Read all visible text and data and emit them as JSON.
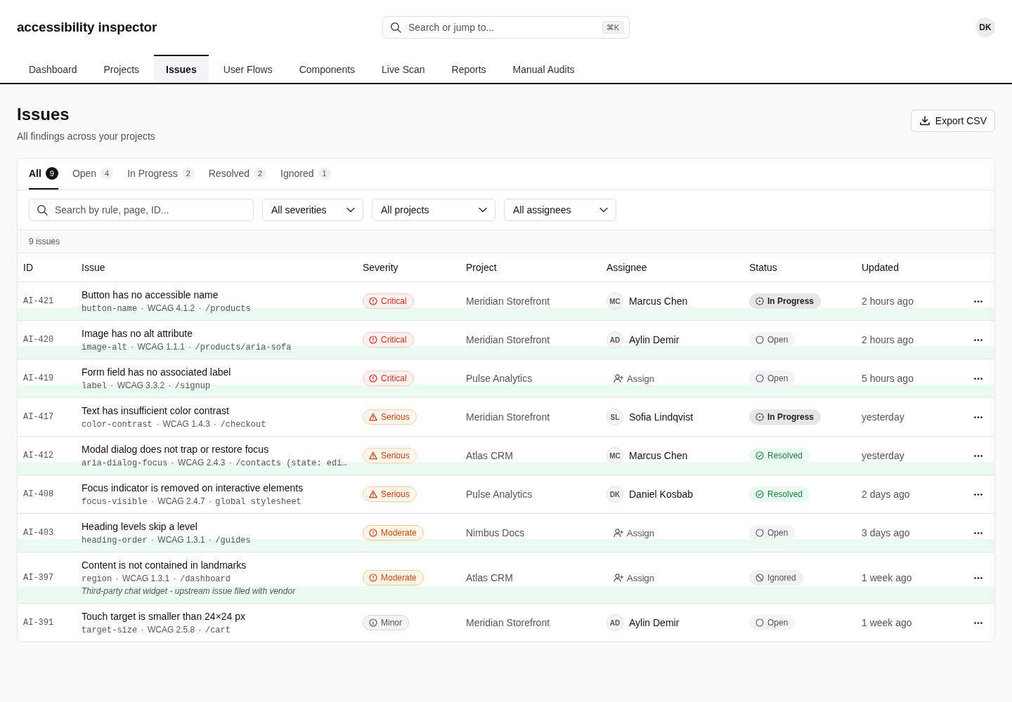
{
  "app": {
    "title": "accessibility inspector",
    "search": {
      "placeholder": "Search or jump to...",
      "shortcut": "⌘K"
    },
    "user_initials": "DK"
  },
  "nav_tabs": [
    {
      "label": "Dashboard",
      "selected": false
    },
    {
      "label": "Projects",
      "selected": false
    },
    {
      "label": "Issues",
      "selected": true
    },
    {
      "label": "User Flows",
      "selected": false
    },
    {
      "label": "Components",
      "selected": false
    },
    {
      "label": "Live Scan",
      "selected": false
    },
    {
      "label": "Reports",
      "selected": false
    },
    {
      "label": "Manual Audits",
      "selected": false
    }
  ],
  "page": {
    "title": "Issues",
    "subtitle": "All findings across your projects",
    "export_button": "Export CSV"
  },
  "status_tabs": [
    {
      "label": "All",
      "count": "9",
      "selected": true
    },
    {
      "label": "Open",
      "count": "4",
      "selected": false
    },
    {
      "label": "In Progress",
      "count": "2",
      "selected": false
    },
    {
      "label": "Resolved",
      "count": "2",
      "selected": false
    },
    {
      "label": "Ignored",
      "count": "1",
      "selected": false
    }
  ],
  "filters": {
    "search_placeholder": "Search by rule, page, ID...",
    "selects": [
      "All severities",
      "All projects",
      "All assignees"
    ]
  },
  "result_count": "9 issues",
  "table": {
    "columns": [
      "ID",
      "Issue",
      "Severity",
      "Project",
      "Assignee",
      "Status",
      "Updated"
    ],
    "rows": [
      {
        "id": "AI-421",
        "title": "Button has no accessible name",
        "meta": [
          {
            "kind": "code",
            "text": "button-name"
          },
          {
            "kind": "sep",
            "text": "·"
          },
          {
            "kind": "plain",
            "text": "WCAG 4.1.2"
          },
          {
            "kind": "sep",
            "text": "·"
          },
          {
            "kind": "code",
            "text": "/products"
          }
        ],
        "severity": {
          "kind": "critical",
          "label": "Critical"
        },
        "project": "Meridian Storefront",
        "assignee": {
          "kind": "person",
          "initials": "MC",
          "name": "Marcus Chen"
        },
        "status": {
          "kind": "in_progress",
          "label": "In Progress"
        },
        "updated": "2 hours ago",
        "highlighted": true
      },
      {
        "id": "AI-420",
        "title": "Image has no alt attribute",
        "meta": [
          {
            "kind": "code",
            "text": "image-alt"
          },
          {
            "kind": "sep",
            "text": "·"
          },
          {
            "kind": "plain",
            "text": "WCAG 1.1.1"
          },
          {
            "kind": "sep",
            "text": "·"
          },
          {
            "kind": "code",
            "text": "/products/aria-sofa"
          }
        ],
        "severity": {
          "kind": "critical",
          "label": "Critical"
        },
        "project": "Meridian Storefront",
        "assignee": {
          "kind": "person",
          "initials": "AD",
          "name": "Aylin Demir"
        },
        "status": {
          "kind": "open",
          "label": "Open"
        },
        "updated": "2 hours ago",
        "highlighted": true
      },
      {
        "id": "AI-419",
        "title": "Form field has no associated label",
        "meta": [
          {
            "kind": "code",
            "text": "label"
          },
          {
            "kind": "sep",
            "text": "·"
          },
          {
            "kind": "plain",
            "text": "WCAG 3.3.2"
          },
          {
            "kind": "sep",
            "text": "·"
          },
          {
            "kind": "code",
            "text": "/signup"
          }
        ],
        "severity": {
          "kind": "critical",
          "label": "Critical"
        },
        "project": "Pulse Analytics",
        "assignee": {
          "kind": "unassigned",
          "label": "Assign"
        },
        "status": {
          "kind": "open",
          "label": "Open"
        },
        "updated": "5 hours ago",
        "highlighted": true
      },
      {
        "id": "AI-417",
        "title": "Text has insufficient color contrast",
        "meta": [
          {
            "kind": "code",
            "text": "color-contrast"
          },
          {
            "kind": "sep",
            "text": "·"
          },
          {
            "kind": "plain",
            "text": "WCAG 1.4.3"
          },
          {
            "kind": "sep",
            "text": "·"
          },
          {
            "kind": "code",
            "text": "/checkout"
          }
        ],
        "severity": {
          "kind": "serious",
          "label": "Serious"
        },
        "project": "Meridian Storefront",
        "assignee": {
          "kind": "person",
          "initials": "SL",
          "name": "Sofia Lindqvist"
        },
        "status": {
          "kind": "in_progress",
          "label": "In Progress"
        },
        "updated": "yesterday",
        "highlighted": false
      },
      {
        "id": "AI-412",
        "title": "Modal dialog does not trap or restore focus",
        "meta": [
          {
            "kind": "code",
            "text": "aria-dialog-focus"
          },
          {
            "kind": "sep",
            "text": "·"
          },
          {
            "kind": "plain",
            "text": "WCAG 2.4.3"
          },
          {
            "kind": "sep",
            "text": "·"
          },
          {
            "kind": "code",
            "text": "/contacts (state: edi…"
          }
        ],
        "severity": {
          "kind": "serious",
          "label": "Serious"
        },
        "project": "Atlas CRM",
        "assignee": {
          "kind": "person",
          "initials": "MC",
          "name": "Marcus Chen"
        },
        "status": {
          "kind": "resolved",
          "label": "Resolved"
        },
        "updated": "yesterday",
        "highlighted": true
      },
      {
        "id": "AI-408",
        "title": "Focus indicator is removed on interactive elements",
        "meta": [
          {
            "kind": "code",
            "text": "focus-visible"
          },
          {
            "kind": "sep",
            "text": "·"
          },
          {
            "kind": "plain",
            "text": "WCAG 2.4.7"
          },
          {
            "kind": "sep",
            "text": "·"
          },
          {
            "kind": "code",
            "text": "global stylesheet"
          }
        ],
        "severity": {
          "kind": "serious",
          "label": "Serious"
        },
        "project": "Pulse Analytics",
        "assignee": {
          "kind": "person",
          "initials": "DK",
          "name": "Daniel Kosbab"
        },
        "status": {
          "kind": "resolved",
          "label": "Resolved"
        },
        "updated": "2 days ago",
        "highlighted": false
      },
      {
        "id": "AI-403",
        "title": "Heading levels skip a level",
        "meta": [
          {
            "kind": "code",
            "text": "heading-order"
          },
          {
            "kind": "sep",
            "text": "·"
          },
          {
            "kind": "plain",
            "text": "WCAG 1.3.1"
          },
          {
            "kind": "sep",
            "text": "·"
          },
          {
            "kind": "code",
            "text": "/guides"
          }
        ],
        "severity": {
          "kind": "moderate",
          "label": "Moderate"
        },
        "project": "Nimbus Docs",
        "assignee": {
          "kind": "unassigned",
          "label": "Assign"
        },
        "status": {
          "kind": "open",
          "label": "Open"
        },
        "updated": "3 days ago",
        "highlighted": true
      },
      {
        "id": "AI-397",
        "title": "Content is not contained in landmarks",
        "meta": [
          {
            "kind": "code",
            "text": "region"
          },
          {
            "kind": "sep",
            "text": "·"
          },
          {
            "kind": "plain",
            "text": "WCAG 1.3.1"
          },
          {
            "kind": "sep",
            "text": "·"
          },
          {
            "kind": "code",
            "text": "/dashboard"
          }
        ],
        "note": "Third-party chat widget - upstream issue filed with vendor",
        "severity": {
          "kind": "moderate",
          "label": "Moderate"
        },
        "project": "Atlas CRM",
        "assignee": {
          "kind": "unassigned",
          "label": "Assign"
        },
        "status": {
          "kind": "ignored",
          "label": "Ignored"
        },
        "updated": "1 week ago",
        "highlighted": true
      },
      {
        "id": "AI-391",
        "title": "Touch target is smaller than 24×24 px",
        "meta": [
          {
            "kind": "code",
            "text": "target-size"
          },
          {
            "kind": "sep",
            "text": "·"
          },
          {
            "kind": "plain",
            "text": "WCAG 2.5.8"
          },
          {
            "kind": "sep",
            "text": "·"
          },
          {
            "kind": "code",
            "text": "/cart"
          }
        ],
        "severity": {
          "kind": "minor",
          "label": "Minor"
        },
        "project": "Meridian Storefront",
        "assignee": {
          "kind": "person",
          "initials": "AD",
          "name": "Aylin Demir"
        },
        "status": {
          "kind": "open",
          "label": "Open"
        },
        "updated": "1 week ago",
        "highlighted": false
      }
    ]
  }
}
